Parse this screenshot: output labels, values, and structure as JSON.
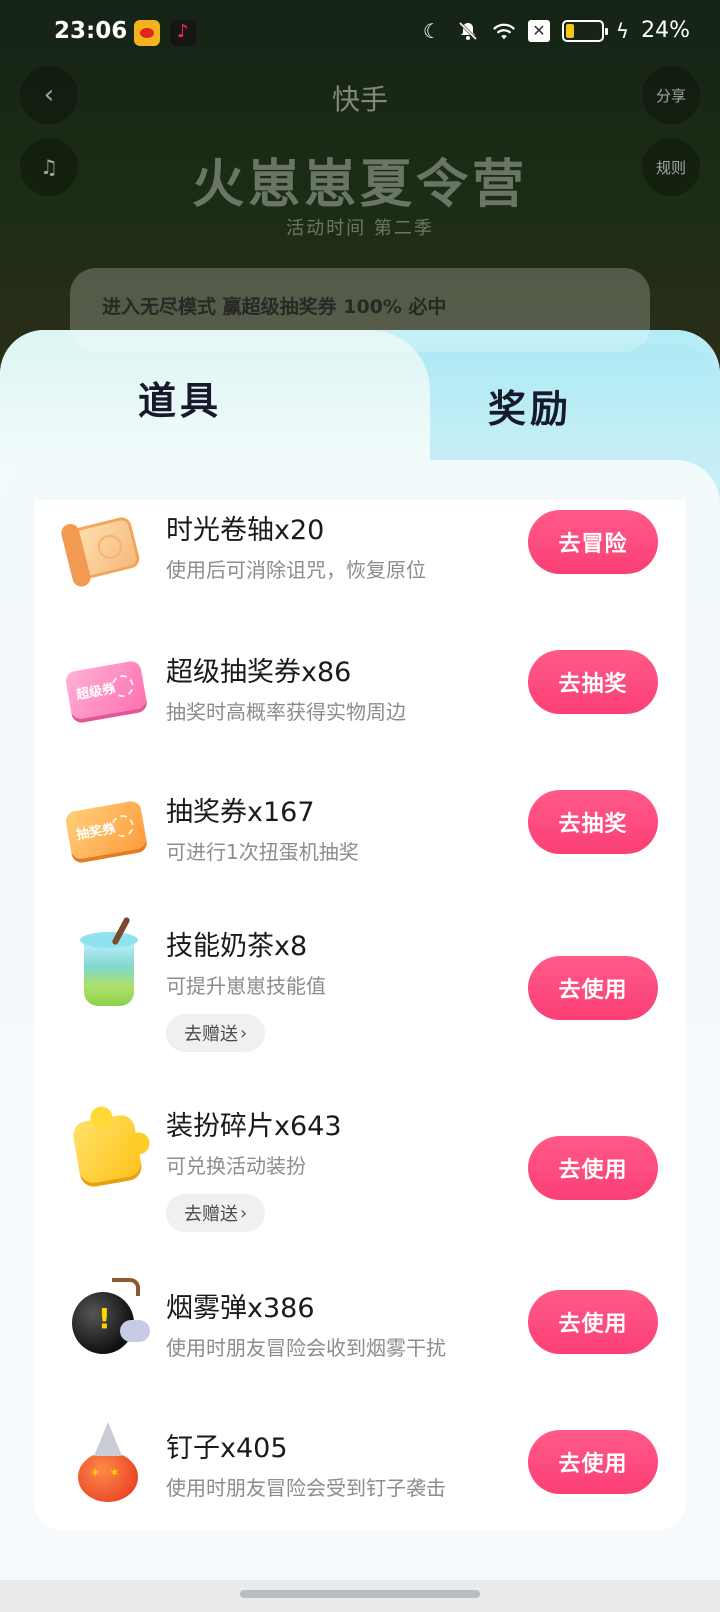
{
  "status_bar": {
    "time": "23:06",
    "notification_apps": [
      "weibo-icon",
      "douyin-icon"
    ],
    "battery_percent": "24%",
    "battery_level": 0.24,
    "icons": [
      "moon-icon",
      "mute-bell-icon",
      "wifi-icon",
      "sim-off-icon",
      "battery-icon",
      "charging-icon"
    ]
  },
  "background_page": {
    "logo": "快手",
    "title": "火崽崽夏令营",
    "subtitle": "活动时间 第二季",
    "share_label": "分享",
    "rules_label": "规则",
    "banner_text": "进入无尽模式 赢超级抽奖券 100% 必中"
  },
  "tabs": [
    {
      "label": "道具",
      "active": true
    },
    {
      "label": "奖励",
      "active": false
    }
  ],
  "items": [
    {
      "name": "时光卷轴x20",
      "desc": "使用后可消除诅咒，恢复原位",
      "button": "去冒险",
      "icon": "scroll-icon"
    },
    {
      "name": "超级抽奖券x86",
      "desc": "抽奖时高概率获得实物周边",
      "button": "去抽奖",
      "icon": "super-ticket-icon",
      "ticket_text": "超级券"
    },
    {
      "name": "抽奖券x167",
      "desc": "可进行1次扭蛋机抽奖",
      "button": "去抽奖",
      "icon": "ticket-icon",
      "ticket_text": "抽奖券"
    },
    {
      "name": "技能奶茶x8",
      "desc": "可提升崽崽技能值",
      "button": "去使用",
      "gift": "去赠送",
      "icon": "milk-tea-icon"
    },
    {
      "name": "装扮碎片x643",
      "desc": "可兑换活动装扮",
      "button": "去使用",
      "gift": "去赠送",
      "icon": "puzzle-piece-icon"
    },
    {
      "name": "烟雾弹x386",
      "desc": "使用时朋友冒险会收到烟雾干扰",
      "button": "去使用",
      "icon": "smoke-bomb-icon"
    },
    {
      "name": "钉子x405",
      "desc": "使用时朋友冒险会受到钉子袭击",
      "button": "去使用",
      "icon": "nail-icon"
    }
  ],
  "colors": {
    "accent_button": "#fb3f74",
    "tab_bg": "#b4ecf5",
    "text_primary": "#1a1a1a",
    "text_secondary": "#8c8c8c"
  }
}
